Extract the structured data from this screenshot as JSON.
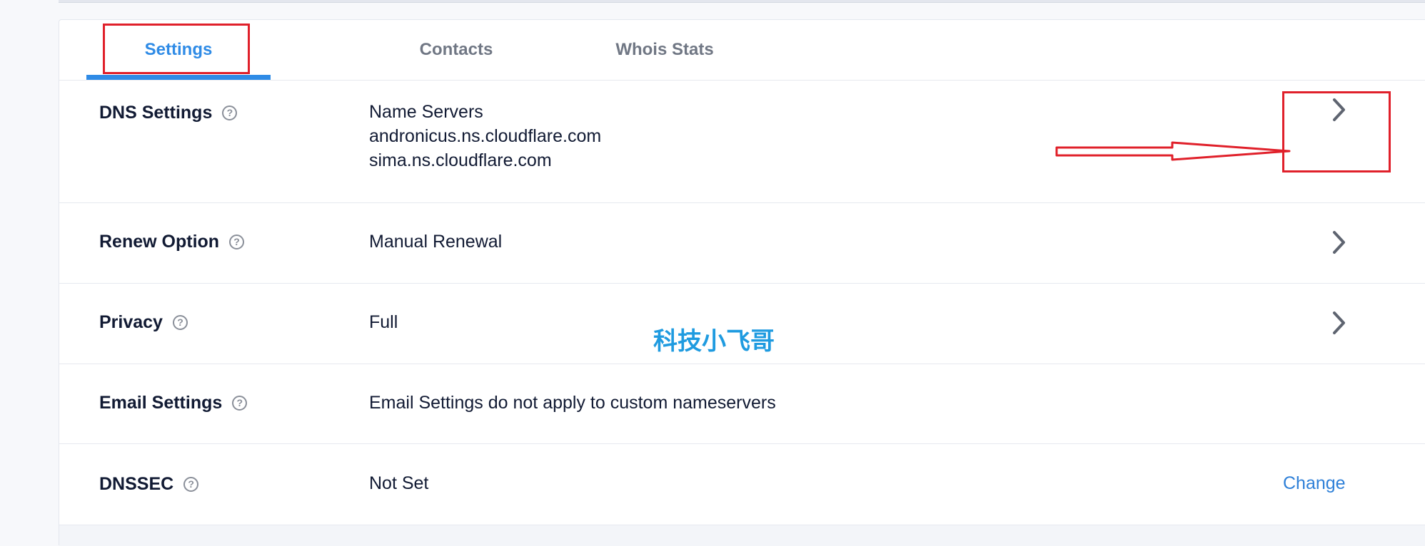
{
  "tabs": [
    {
      "label": "Settings",
      "active": true
    },
    {
      "label": "Contacts",
      "active": false
    },
    {
      "label": "Whois Stats",
      "active": false
    }
  ],
  "rows": {
    "dns": {
      "label": "DNS Settings",
      "value_title": "Name Servers",
      "nameservers": [
        "andronicus.ns.cloudflare.com",
        "sima.ns.cloudflare.com"
      ]
    },
    "renew": {
      "label": "Renew Option",
      "value": "Manual Renewal"
    },
    "privacy": {
      "label": "Privacy",
      "value": "Full"
    },
    "email": {
      "label": "Email Settings",
      "value": "Email Settings do not apply to custom nameservers"
    },
    "dnssec": {
      "label": "DNSSEC",
      "value": "Not Set",
      "action": "Change"
    }
  },
  "help_glyph": "?",
  "watermark": "科技小飞哥",
  "colors": {
    "accent": "#2f8be6",
    "annotation_red": "#e0202a",
    "watermark": "#1f9be0",
    "text": "#111a33",
    "muted": "#707784"
  },
  "icons": {
    "help": "question-circle-icon",
    "row_action": "chevron-right-icon"
  }
}
